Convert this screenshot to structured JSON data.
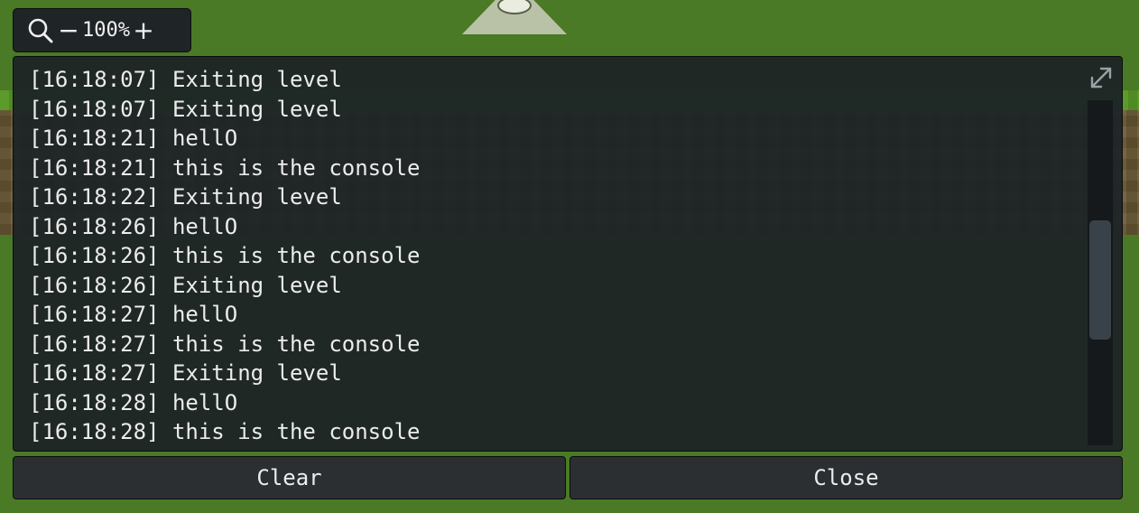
{
  "zoom": {
    "level": "100%",
    "minus_label": "−",
    "plus_label": "+"
  },
  "console": {
    "lines": [
      "[16:18:07] Exiting level",
      "[16:18:07] Exiting level",
      "[16:18:21] hellO",
      "[16:18:21] this is the console",
      "[16:18:22] Exiting level",
      "[16:18:26] hellO",
      "[16:18:26] this is the console",
      "[16:18:26] Exiting level",
      "[16:18:27] hellO",
      "[16:18:27] this is the console",
      "[16:18:27] Exiting level",
      "[16:18:28] hellO",
      "[16:18:28] this is the console"
    ]
  },
  "buttons": {
    "clear_label": "Clear",
    "close_label": "Close"
  },
  "colors": {
    "background_grass": "#4a7a25",
    "panel": "#1d2325",
    "text": "#ececec"
  }
}
